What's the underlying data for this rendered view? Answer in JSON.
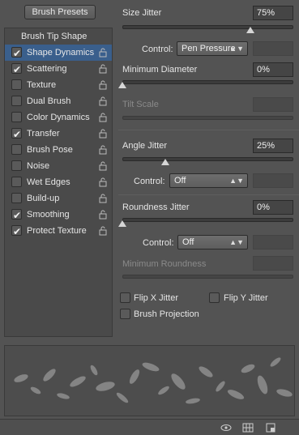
{
  "header": {
    "presets_label": "Brush Presets"
  },
  "left_list": {
    "title": "Brush Tip Shape",
    "items": [
      {
        "label": "Shape Dynamics",
        "checked": true,
        "selected": true
      },
      {
        "label": "Scattering",
        "checked": true,
        "selected": false
      },
      {
        "label": "Texture",
        "checked": false,
        "selected": false
      },
      {
        "label": "Dual Brush",
        "checked": false,
        "selected": false
      },
      {
        "label": "Color Dynamics",
        "checked": false,
        "selected": false
      },
      {
        "label": "Transfer",
        "checked": true,
        "selected": false
      },
      {
        "label": "Brush Pose",
        "checked": false,
        "selected": false
      },
      {
        "label": "Noise",
        "checked": false,
        "selected": false
      },
      {
        "label": "Wet Edges",
        "checked": false,
        "selected": false
      },
      {
        "label": "Build-up",
        "checked": false,
        "selected": false
      },
      {
        "label": "Smoothing",
        "checked": true,
        "selected": false
      },
      {
        "label": "Protect Texture",
        "checked": true,
        "selected": false
      }
    ]
  },
  "settings": {
    "size_jitter": {
      "label": "Size Jitter",
      "value": "75%",
      "level": 0.75
    },
    "size_control": {
      "label": "Control:",
      "value": "Pen Pressure"
    },
    "min_diameter": {
      "label": "Minimum Diameter",
      "value": "0%",
      "level": 0
    },
    "tilt_scale": {
      "label": "Tilt Scale"
    },
    "angle_jitter": {
      "label": "Angle Jitter",
      "value": "25%",
      "level": 0.25
    },
    "angle_control": {
      "label": "Control:",
      "value": "Off"
    },
    "roundness_jitter": {
      "label": "Roundness Jitter",
      "value": "0%",
      "level": 0
    },
    "roundness_control": {
      "label": "Control:",
      "value": "Off"
    },
    "min_roundness": {
      "label": "Minimum Roundness"
    },
    "flip_x": {
      "label": "Flip X Jitter",
      "checked": false
    },
    "flip_y": {
      "label": "Flip Y Jitter",
      "checked": false
    },
    "brush_projection": {
      "label": "Brush Projection",
      "checked": false
    }
  },
  "colors": {
    "selected_row": "#3a5f8c",
    "panel_bg": "#535353"
  }
}
